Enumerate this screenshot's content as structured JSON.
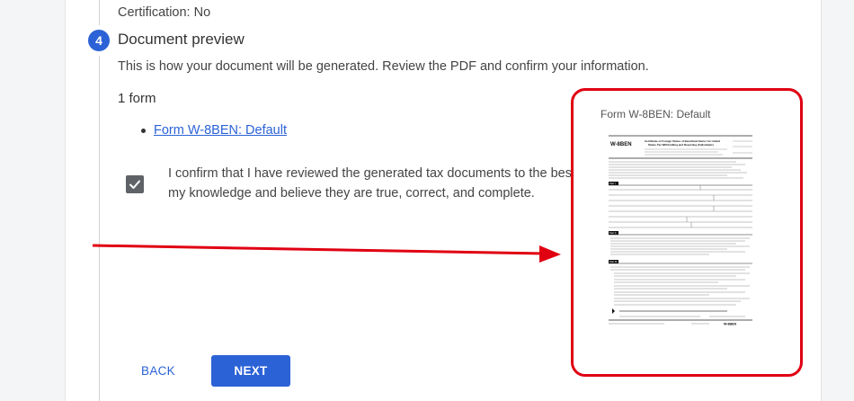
{
  "previous_step": {
    "certification": "Certification: No"
  },
  "step": {
    "number": "4",
    "title": "Document preview",
    "description": "This is how your document will be generated. Review the PDF and confirm your information."
  },
  "forms": {
    "count_label": "1 form",
    "items": [
      {
        "label": "Form W-8BEN: Default"
      }
    ]
  },
  "confirmation": {
    "checked": true,
    "line1": "I confirm that I have reviewed the generated tax documents to the best of",
    "line2": "my knowledge and believe they are true, correct, and complete."
  },
  "buttons": {
    "back": "BACK",
    "next": "NEXT"
  },
  "preview": {
    "title": "Form W-8BEN: Default",
    "document": {
      "form_id": "W-8BEN",
      "heading_line1": "Certificate of Foreign Status of Beneficial Owner for United",
      "heading_line2": "States Tax Withholding and Reporting (Individuals)",
      "part1": "Part I",
      "part2": "Part II",
      "part3": "Part III",
      "footer_form": "W-8BEN"
    }
  },
  "colors": {
    "accent": "#2b62d6",
    "annotation": "#e00012",
    "checkbox": "#5f6368"
  }
}
